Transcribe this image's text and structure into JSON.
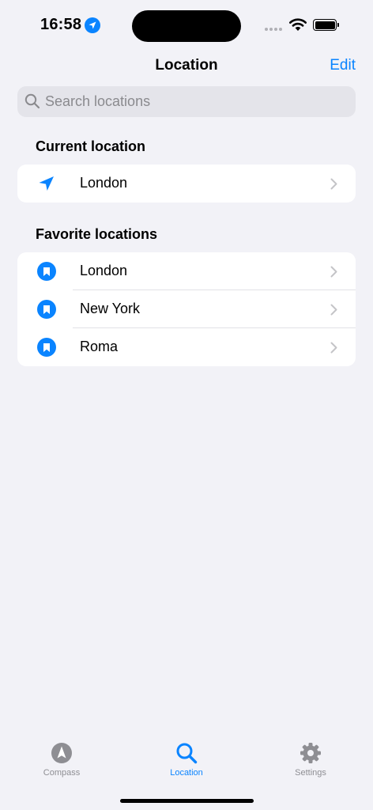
{
  "status_bar": {
    "time": "16:58"
  },
  "nav": {
    "title": "Location",
    "edit_label": "Edit"
  },
  "search": {
    "placeholder": "Search locations",
    "value": ""
  },
  "current_section": {
    "header": "Current location",
    "item": {
      "label": "London",
      "icon": "location-arrow-icon"
    }
  },
  "favorites_section": {
    "header": "Favorite locations",
    "items": [
      {
        "label": "London",
        "icon": "bookmark-icon"
      },
      {
        "label": "New York",
        "icon": "bookmark-icon"
      },
      {
        "label": "Roma",
        "icon": "bookmark-icon"
      }
    ]
  },
  "tab_bar": {
    "tabs": [
      {
        "label": "Compass",
        "icon": "compass-icon",
        "selected": false
      },
      {
        "label": "Location",
        "icon": "search-icon",
        "selected": true
      },
      {
        "label": "Settings",
        "icon": "gear-icon",
        "selected": false
      }
    ]
  },
  "colors": {
    "accent": "#0a84ff",
    "inactive": "#8e8e93",
    "background": "#f2f2f7"
  }
}
